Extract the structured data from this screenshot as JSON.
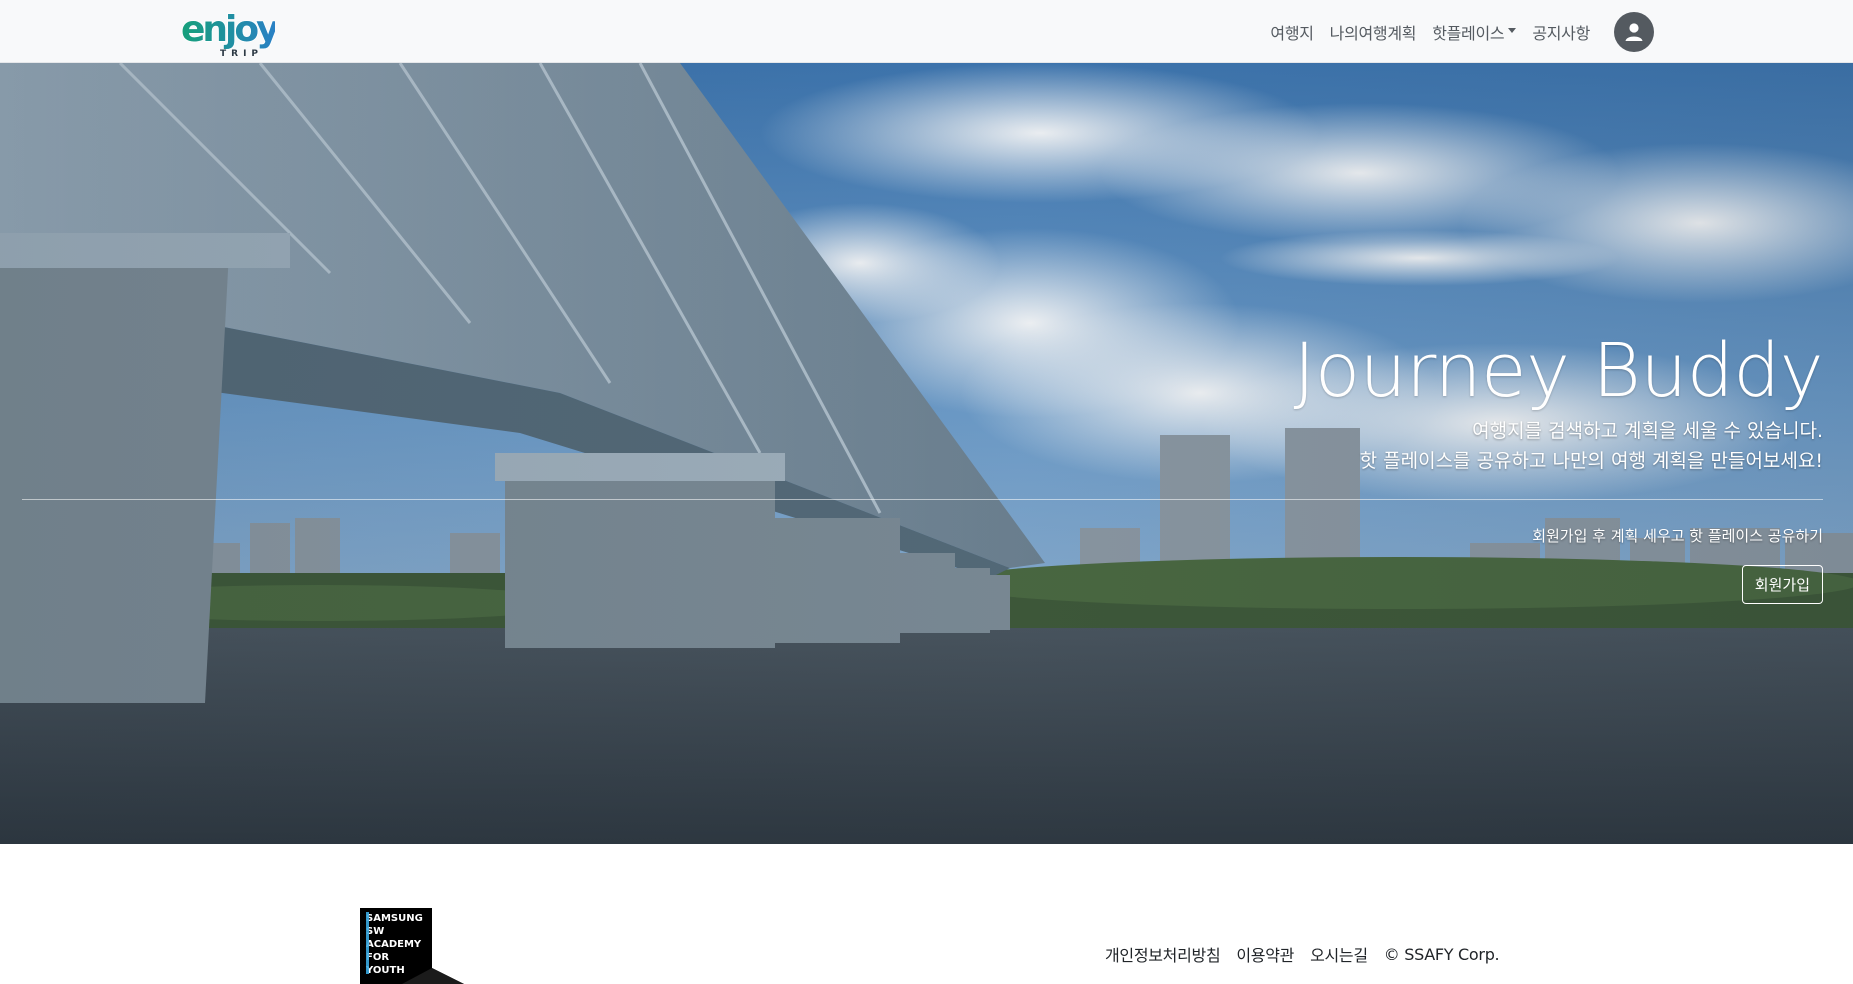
{
  "navbar": {
    "logo": {
      "text": "enjoy",
      "subtext": "TRIP"
    },
    "items": [
      {
        "label": "여행지"
      },
      {
        "label": "나의여행계획"
      },
      {
        "label": "핫플레이스"
      },
      {
        "label": "공지사항"
      }
    ],
    "profile_icon": "user-icon"
  },
  "hero": {
    "title": "Journey Buddy",
    "lead_line1": "여행지를 검색하고 계획을 세울 수 있습니다.",
    "lead_line2": "핫 플레이스를 공유하고 나만의 여행 계획을 만들어보세요!",
    "cta_text": "회원가입 후 계획 세우고 핫 플레이스 공유하기",
    "cta_button": "회원가입"
  },
  "footer": {
    "logo_lines": [
      "SAMSUNG",
      "SW",
      "ACADEMY",
      "FOR",
      "YOUTH"
    ],
    "links": [
      "개인정보처리방침",
      "이용약관",
      "오시는길"
    ],
    "copyright": "© SSAFY Corp."
  },
  "colors": {
    "navbar_bg": "#f8f9fa",
    "nav_text": "#555b61",
    "logo_green": "#1aa37a",
    "logo_blue": "#2f86c4",
    "sky": "#5e93c4",
    "water": "#3a4650"
  }
}
